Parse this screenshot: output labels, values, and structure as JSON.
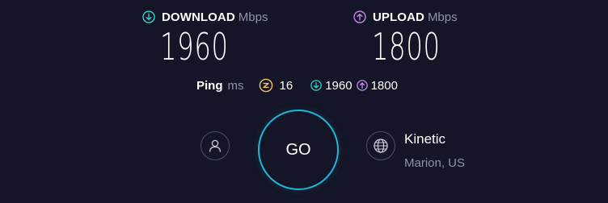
{
  "download": {
    "label": "DOWNLOAD",
    "unit": "Mbps",
    "value": "1960",
    "icon": "download-arrow-icon",
    "color": "#2ad4c9"
  },
  "upload": {
    "label": "UPLOAD",
    "unit": "Mbps",
    "value": "1800",
    "icon": "upload-arrow-icon",
    "color": "#c984ef"
  },
  "ping": {
    "label": "Ping",
    "unit": "ms",
    "value": "16",
    "icon": "ping-icon",
    "icon_color": "#f4c46a",
    "download_value": "1960",
    "upload_value": "1800"
  },
  "go_button": {
    "label": "GO",
    "ring_color": "#1fb7d9"
  },
  "account": {
    "icon": "user-icon"
  },
  "provider": {
    "icon": "globe-icon",
    "name": "Kinetic",
    "location": "Marion, US"
  }
}
